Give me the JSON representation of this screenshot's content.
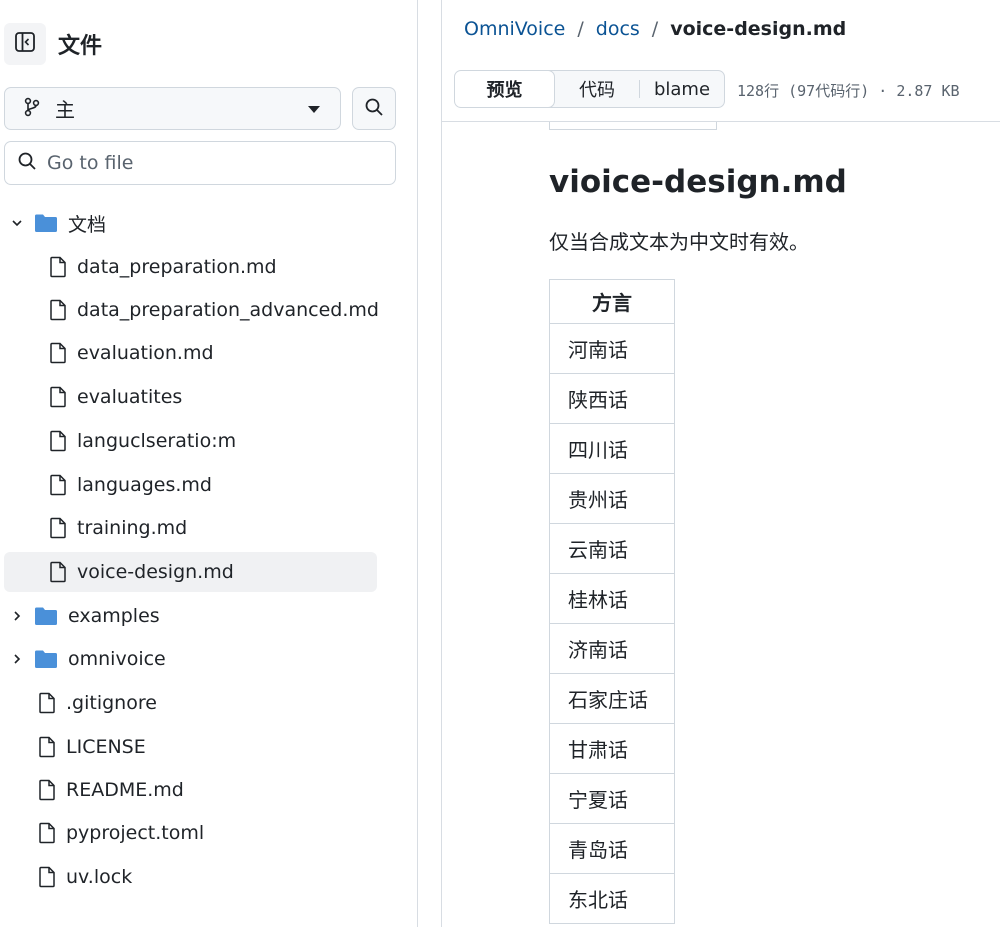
{
  "sidebar": {
    "title": "文件",
    "branch": "主",
    "goto_placeholder": "Go to file",
    "tree": [
      {
        "label": "文档",
        "type": "folder",
        "expanded": true,
        "depth": 0,
        "icon": "folder-icon"
      },
      {
        "label": "data_preparation.md",
        "type": "file",
        "depth": 1,
        "icon": "file-icon"
      },
      {
        "label": "data_preparation_advanced.md",
        "type": "file",
        "depth": 1,
        "icon": "file-icon"
      },
      {
        "label": "evaluation.md",
        "type": "file",
        "depth": 1,
        "icon": "file-icon"
      },
      {
        "label": "evaluatites",
        "type": "file",
        "depth": 1,
        "icon": "file-icon"
      },
      {
        "label": "languclseratio:m",
        "type": "file",
        "depth": 1,
        "icon": "file-icon"
      },
      {
        "label": "languages.md",
        "type": "file",
        "depth": 1,
        "icon": "file-icon"
      },
      {
        "label": "training.md",
        "type": "file",
        "depth": 1,
        "icon": "file-icon"
      },
      {
        "label": "voice-design.md",
        "type": "file",
        "depth": 1,
        "icon": "file-icon",
        "active": true
      },
      {
        "label": "examples",
        "type": "folder",
        "expanded": false,
        "depth": 0,
        "icon": "folder-icon"
      },
      {
        "label": "omnivoice",
        "type": "folder",
        "expanded": false,
        "depth": 0,
        "icon": "folder-icon"
      },
      {
        "label": ".gitignore",
        "type": "file",
        "depth": 0,
        "icon": "file-icon"
      },
      {
        "label": "LICENSE",
        "type": "file",
        "depth": 0,
        "icon": "file-icon"
      },
      {
        "label": "README.md",
        "type": "file",
        "depth": 0,
        "icon": "file-icon"
      },
      {
        "label": "pyproject.toml",
        "type": "file",
        "depth": 0,
        "icon": "file-icon"
      },
      {
        "label": "uv.lock",
        "type": "file",
        "depth": 0,
        "icon": "file-icon"
      }
    ]
  },
  "breadcrumb": {
    "repo": "OmniVoice",
    "sep1": "/",
    "dir": "docs",
    "sep2": "/",
    "file": "voice-design.md"
  },
  "file_bar": {
    "tab_preview": "预览",
    "tab_code": "代码",
    "tab_blame": "blame",
    "selected_tab": "预览",
    "meta": "128行 (97代码行) · 2.87 KB"
  },
  "document": {
    "title": "vioice-design.md",
    "description": "仅当合成文本为中文时有效。",
    "table_header": "方言",
    "table_rows": [
      "河南话",
      "陕西话",
      "四川话",
      "贵州话",
      "云南话",
      "桂林话",
      "济南话",
      "石家庄话",
      "甘肃话",
      "宁夏话",
      "青岛话",
      "东北话"
    ]
  },
  "colors": {
    "link": "#0b5394",
    "folder": "#4a90d9",
    "border": "#d0d7de",
    "active_row": "#f0f1f3"
  }
}
